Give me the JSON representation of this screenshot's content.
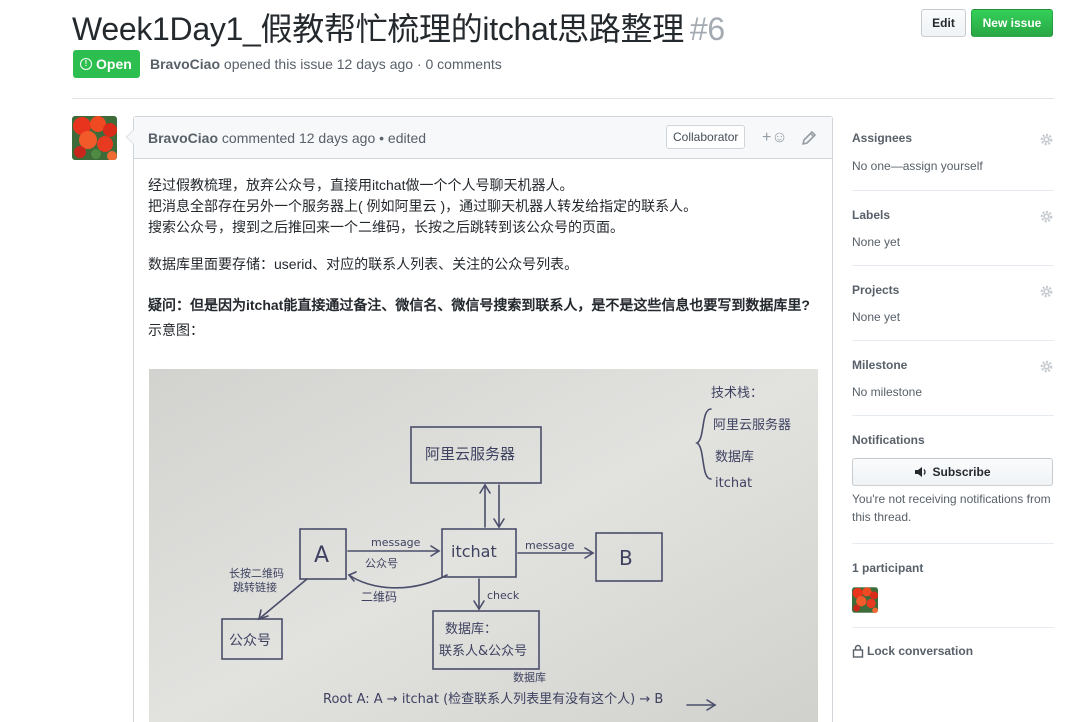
{
  "issue": {
    "title": "Week1Day1_假教帮忙梳理的itchat思路整理",
    "number": "#6",
    "state": "Open",
    "author": "BravoCiao",
    "meta_text": " opened this issue 12 days ago · 0 comments"
  },
  "header_buttons": {
    "edit": "Edit",
    "new_issue": "New issue"
  },
  "comment": {
    "author": "BravoCiao",
    "meta_text": " commented 12 days ago • edited",
    "badge": "Collaborator",
    "reaction_glyph": "+☺",
    "paragraph1": [
      "经过假教梳理，放弃公众号，直接用itchat做一个个人号聊天机器人。",
      "把消息全部存在另外一个服务器上( 例如阿里云 )，通过聊天机器人转发给指定的联系人。",
      "搜索公众号，搜到之后推回来一个二维码，长按之后跳转到该公众号的页面。"
    ],
    "paragraph2": "数据库里面要存储：userid、对应的联系人列表、关注的公众号列表。",
    "question": "疑问：但是因为itchat能直接通过备注、微信名、微信号搜索到联系人，是不是这些信息也要写到数据库里?",
    "diagram_caption": "示意图：",
    "diagram_labels": {
      "tech_stack": "技术栈：",
      "tech1": "阿里云服务器",
      "tech2": "数据库",
      "tech3": "itchat",
      "server": "阿里云服务器",
      "a": "A",
      "itchat": "itchat",
      "b": "B",
      "message1": "message",
      "gzh_small": "公众号",
      "message2": "message",
      "qr": "二维码",
      "press": "长按二维码",
      "press2": "跳转链接",
      "gzh": "公众号",
      "check": "check",
      "db": "数据库：",
      "db2": "联系人&公众号",
      "route": "Root A:  A → itchat (检查联系人列表里有没有这个人) → B",
      "route_note": "数据库"
    }
  },
  "sidebar": {
    "assignees": {
      "title": "Assignees",
      "value": "No one—assign yourself"
    },
    "labels": {
      "title": "Labels",
      "value": "None yet"
    },
    "projects": {
      "title": "Projects",
      "value": "None yet"
    },
    "milestone": {
      "title": "Milestone",
      "value": "No milestone"
    },
    "notifications": {
      "title": "Notifications",
      "button": "Subscribe",
      "note": "You're not receiving notifications from this thread."
    },
    "participants": {
      "title": "1 participant"
    },
    "lock": "Lock conversation"
  },
  "colors": {
    "open_green": "#2cbe4e",
    "new_issue_green": "#28a745",
    "text": "#24292e",
    "muted": "#586069"
  },
  "icons": [
    "issue-opened-icon",
    "smiley-icon",
    "pencil-icon",
    "gear-icon",
    "speaker-icon",
    "lock-icon"
  ]
}
